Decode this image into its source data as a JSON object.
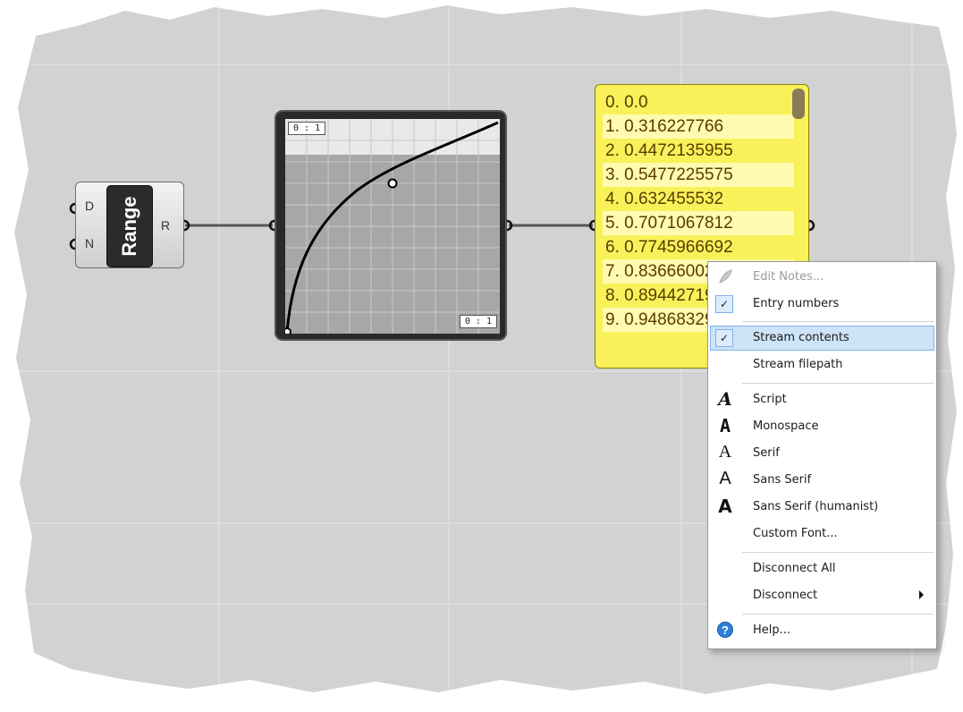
{
  "range_component": {
    "title": "Range",
    "inputs": [
      "D",
      "N"
    ],
    "output": "R"
  },
  "graph_mapper": {
    "domain_top": "0 : 1",
    "domain_bottom": "0 : 1"
  },
  "panel": {
    "rows": [
      "0. 0.0",
      "1. 0.316227766",
      "2. 0.4472135955",
      "3. 0.5477225575",
      "4. 0.632455532",
      "5. 0.7071067812",
      "6. 0.7745966692",
      "7. 0.8366600265",
      "8. 0.894427191",
      "9. 0.9486832981"
    ]
  },
  "context_menu": {
    "edit_notes": "Edit Notes...",
    "entry_numbers": "Entry numbers",
    "stream_contents": "Stream contents",
    "stream_filepath": "Stream filepath",
    "script": "Script",
    "monospace": "Monospace",
    "serif": "Serif",
    "sans_serif": "Sans Serif",
    "sans_serif_humanist": "Sans Serif (humanist)",
    "custom_font": "Custom Font...",
    "disconnect_all": "Disconnect All",
    "disconnect": "Disconnect",
    "help": "Help...",
    "checked_items": [
      "Entry numbers",
      "Stream contents"
    ],
    "highlighted_item": "Stream contents"
  },
  "colors": {
    "panel_fill": "#f8f15a",
    "panel_text": "#5a3c00",
    "menu_highlight": "#cde3f7",
    "help_icon": "#2f7fd8"
  },
  "icons": {
    "edit_notes": "feather-icon",
    "checked": "checkmark-icon",
    "font_sample": "letter-a-icon",
    "submenu": "triangle-right-icon",
    "help": "question-mark-icon"
  }
}
